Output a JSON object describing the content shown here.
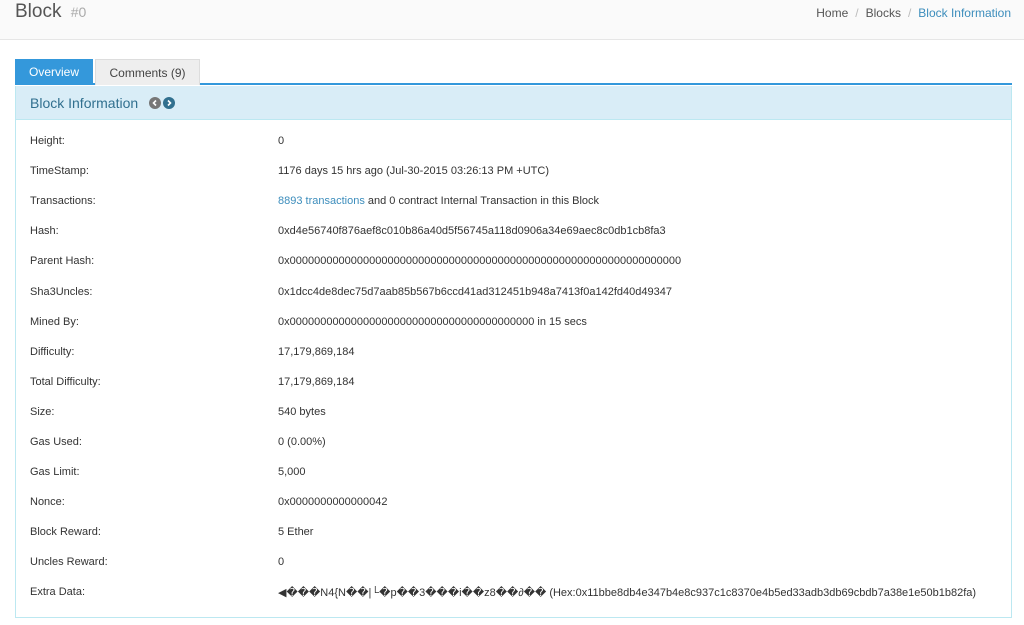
{
  "header": {
    "title": "Block",
    "subtitle": "#0",
    "breadcrumb": [
      "Home",
      "Blocks",
      "Block Information"
    ]
  },
  "tabs": [
    {
      "label": "Overview",
      "active": true
    },
    {
      "label": "Comments (9)",
      "active": false
    }
  ],
  "panel": {
    "title": "Block Information",
    "icons": [
      "chevron-left-circle-icon",
      "chevron-right-circle-icon"
    ]
  },
  "rows": [
    {
      "label": "Height:",
      "value": " 0"
    },
    {
      "label": "TimeStamp:",
      "value": "1176 days 15 hrs ago (Jul-30-2015 03:26:13 PM +UTC)"
    },
    {
      "label": "Transactions:",
      "link": "8893 transactions",
      "value": " and 0 contract Internal Transaction in this Block"
    },
    {
      "label": "Hash:",
      "value": "0xd4e56740f876aef8c010b86a40d5f56745a118d0906a34e69aec8c0db1cb8fa3"
    },
    {
      "label": "Parent Hash:",
      "value": "0x0000000000000000000000000000000000000000000000000000000000000000"
    },
    {
      "label": "Sha3Uncles:",
      "value": "0x1dcc4de8dec75d7aab85b567b6ccd41ad312451b948a7413f0a142fd40d49347"
    },
    {
      "label": "Mined By:",
      "value": "0x0000000000000000000000000000000000000000 in 15 secs"
    },
    {
      "label": "Difficulty:",
      "value": "17,179,869,184"
    },
    {
      "label": "Total Difficulty:",
      "value": "17,179,869,184"
    },
    {
      "label": "Size:",
      "value": "540 bytes"
    },
    {
      "label": "Gas Used:",
      "value": "0 (0.00%)"
    },
    {
      "label": "Gas Limit:",
      "value": "5,000"
    },
    {
      "label": "Nonce:",
      "value": "0x0000000000000042"
    },
    {
      "label": "Block Reward:",
      "value": "5 Ether"
    },
    {
      "label": "Uncles Reward:",
      "value": "0"
    },
    {
      "label": "Extra Data:",
      "value": "◀���N4{N��|└�p��3���i��z8��∂�� (Hex:0x11bbe8db4e347b4e8c937c1c8370e4b5ed33adb3db69cbdb7a38e1e50b1b82fa)"
    }
  ]
}
